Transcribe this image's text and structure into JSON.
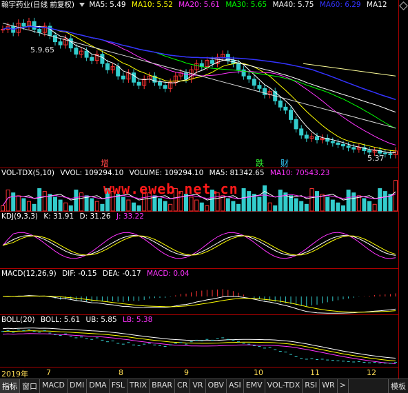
{
  "stock": {
    "name": "翰宇药业",
    "mode": "(日线 前复权)"
  },
  "main": {
    "indicators": [
      {
        "label": "MA5: 5.49",
        "color": "#ffffff"
      },
      {
        "label": "MA10: 5.52",
        "color": "#ffff00"
      },
      {
        "label": "MA20: 5.61",
        "color": "#ff33ff"
      },
      {
        "label": "MA30: 5.65",
        "color": "#00ff00"
      },
      {
        "label": "MA40: 5.75",
        "color": "#ffffff"
      },
      {
        "label": "MA60: 6.29",
        "color": "#3333ff"
      },
      {
        "label": "MA12",
        "color": "#ffffff"
      }
    ],
    "high_label": "5.9.65",
    "low_label": "5.37",
    "markers": [
      {
        "text": "增",
        "color": "#ff4444"
      },
      {
        "text": "跌",
        "color": "#33ff33"
      },
      {
        "text": "财",
        "color": "#33ccff"
      }
    ]
  },
  "volume": {
    "name": "VOL-TDX(5,10)",
    "items": [
      {
        "label": "VVOL: 109294.10",
        "color": "#ffffff"
      },
      {
        "label": "VOLUME: 109294.10",
        "color": "#ffffff"
      },
      {
        "label": "MA5: 81342.65",
        "color": "#ffffff"
      },
      {
        "label": "MA10: 70543.23",
        "color": "#ff33ff"
      }
    ]
  },
  "kdj": {
    "name": "KDJ(9,3,3)",
    "items": [
      {
        "label": "K: 31.91",
        "color": "#ffffff"
      },
      {
        "label": "D: 31.26",
        "color": "#ffffff"
      },
      {
        "label": "J: 33.22",
        "color": "#ff33ff"
      }
    ]
  },
  "macd": {
    "name": "MACD(12,26,9)",
    "items": [
      {
        "label": "DIF: -0.15",
        "color": "#ffffff"
      },
      {
        "label": "DEA: -0.17",
        "color": "#ffffff"
      },
      {
        "label": "MACD: 0.04",
        "color": "#ff33ff"
      }
    ]
  },
  "boll": {
    "name": "BOLL(20)",
    "items": [
      {
        "label": "BOLL: 5.61",
        "color": "#ffffff"
      },
      {
        "label": "UB: 5.85",
        "color": "#ffffff"
      },
      {
        "label": "LB: 5.38",
        "color": "#ff33ff"
      }
    ]
  },
  "watermark": "www.eweb.net.cn",
  "xaxis": {
    "labels": [
      "2019年",
      "7",
      "8",
      "9",
      "10",
      "11",
      "12"
    ]
  },
  "tabs": [
    "指标",
    "窗口",
    "MACD",
    "DMI",
    "DMA",
    "FSL",
    "TRIX",
    "BRAR",
    "CR",
    "VR",
    "OBV",
    "ASI",
    "EMV",
    "VOL-TDX",
    "RSI",
    "WR",
    ">",
    "模板"
  ],
  "chart_data": {
    "type": "candlestick",
    "x_labels": [
      "2019年",
      "7",
      "8",
      "9",
      "10",
      "11",
      "12"
    ],
    "close": [
      9.4,
      9.5,
      9.3,
      9.6,
      9.5,
      9.65,
      9.4,
      9.3,
      9.5,
      9.2,
      9.0,
      8.9,
      9.1,
      8.8,
      8.6,
      8.7,
      8.5,
      8.4,
      8.6,
      8.3,
      8.1,
      8.2,
      7.9,
      7.8,
      8.0,
      7.7,
      7.6,
      7.8,
      7.9,
      7.7,
      7.6,
      7.5,
      7.7,
      7.9,
      8.0,
      7.8,
      8.1,
      8.3,
      8.2,
      8.4,
      8.3,
      8.5,
      8.6,
      8.4,
      8.3,
      8.1,
      7.9,
      7.8,
      7.6,
      7.5,
      7.3,
      7.4,
      7.1,
      6.9,
      6.8,
      6.5,
      6.2,
      6.0,
      5.9,
      5.95,
      5.85,
      5.9,
      5.8,
      5.75,
      5.7,
      5.65,
      5.6,
      5.55,
      5.6,
      5.5,
      5.45,
      5.5,
      5.42,
      5.4,
      5.37,
      5.49
    ]
  }
}
